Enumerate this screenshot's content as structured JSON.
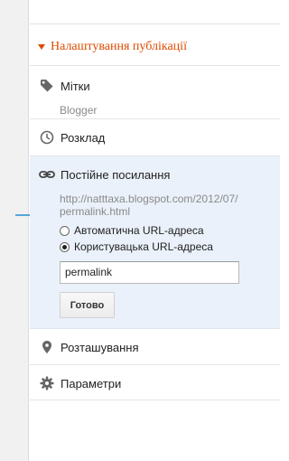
{
  "section": {
    "title": "Налаштування публікації"
  },
  "items": {
    "labels": {
      "label": "Мітки",
      "value": "Blogger",
      "icon": "tag-icon"
    },
    "schedule": {
      "label": "Розклад",
      "icon": "clock-icon"
    },
    "permalink": {
      "label": "Постійне посилання",
      "icon": "link-icon",
      "url_line1": "http://natttaxa.blogspot.com/2012/07/",
      "url_line2": "permalink.html",
      "option_auto": "Автоматична URL-адреса",
      "option_custom": "Користувацька URL-адреса",
      "selected_option": "custom",
      "input_value": "permalink",
      "done_label": "Готово"
    },
    "location": {
      "label": "Розташування",
      "icon": "location-pin-icon"
    },
    "options": {
      "label": "Параметри",
      "icon": "gear-icon"
    }
  },
  "colors": {
    "accent": "#dd4b00",
    "arrow": "#1f8dd6",
    "highlight": "#eaf1fb"
  }
}
